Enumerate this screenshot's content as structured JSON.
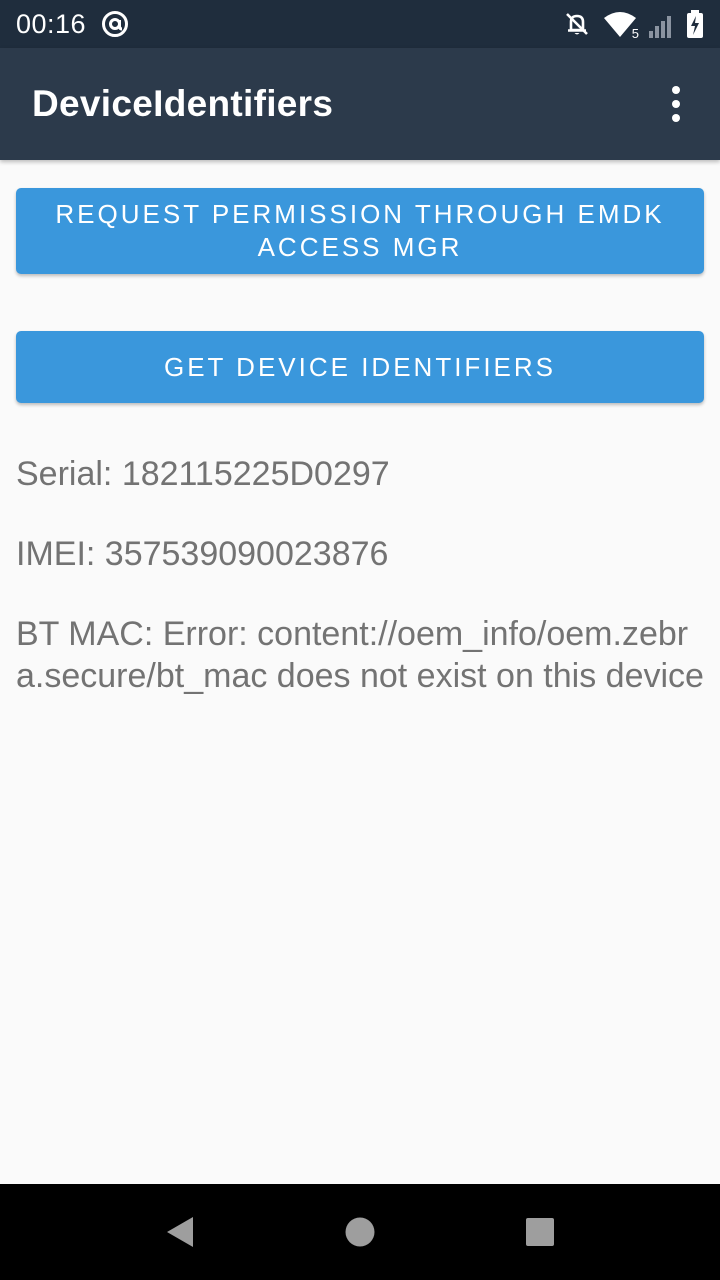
{
  "status_bar": {
    "time": "00:16",
    "icons": [
      "at-sign-icon",
      "notifications-off-icon",
      "wifi-icon",
      "signal-icon",
      "battery-charging-icon"
    ],
    "wifi_badge": "5"
  },
  "app_bar": {
    "title": "DeviceIdentifiers",
    "menu_icon": "overflow-menu-icon"
  },
  "buttons": {
    "request_permission": "REQUEST PERMISSION THROUGH EMDK ACCESS MGR",
    "get_identifiers": "GET DEVICE IDENTIFIERS"
  },
  "info": {
    "serial": "Serial: 182115225D0297",
    "imei": "IMEI: 357539090023876",
    "bt_mac": "BT MAC: Error: content://oem_info/oem.zebra.secure/bt_mac does not exist on this device"
  },
  "nav_bar": {
    "icons": [
      "back-icon",
      "home-icon",
      "recents-icon"
    ]
  },
  "colors": {
    "status_bar": "#1f2d3d",
    "app_bar": "#2c3a4b",
    "button": "#3a97dc",
    "background": "#fafafa",
    "text": "#737373"
  }
}
